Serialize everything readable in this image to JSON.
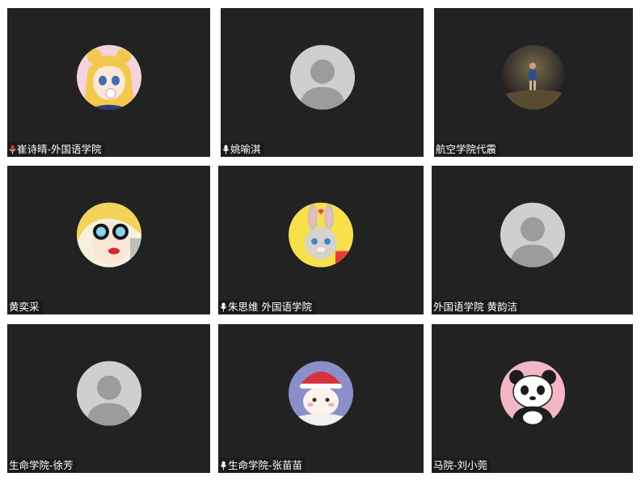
{
  "colors": {
    "tile_background": "#222222",
    "name_tag_background": "#1b1b1b",
    "name_text": "#ffffff",
    "placeholder_avatar": "#cfcfcf",
    "placeholder_silhouette": "#9c9c9c",
    "mic_muted_accent": "#e0322e"
  },
  "participants": [
    {
      "name": "崔诗晴-外国语学院",
      "avatar": "anime-girl-avatar",
      "mic": "mic-muted-icon"
    },
    {
      "name": "姚喻淇",
      "avatar": "default-person-avatar",
      "mic": "mic-icon"
    },
    {
      "name": "航空学院代震",
      "avatar": "photo-night-person-avatar",
      "mic": ""
    },
    {
      "name": "黄奕采",
      "avatar": "cartoon-sunglasses-avatar",
      "mic": ""
    },
    {
      "name": "朱思维  外国语学院",
      "avatar": "cartoon-rabbit-avatar",
      "mic": "mic-icon"
    },
    {
      "name": "外国语学院 黄韵洁",
      "avatar": "default-person-avatar",
      "mic": ""
    },
    {
      "name": "生命学院-徐芳",
      "avatar": "default-person-avatar",
      "mic": ""
    },
    {
      "name": "生命学院-张苗苗",
      "avatar": "cartoon-cat-santa-avatar",
      "mic": "mic-icon"
    },
    {
      "name": "马院-刘小莞",
      "avatar": "cartoon-panda-avatar",
      "mic": ""
    }
  ]
}
